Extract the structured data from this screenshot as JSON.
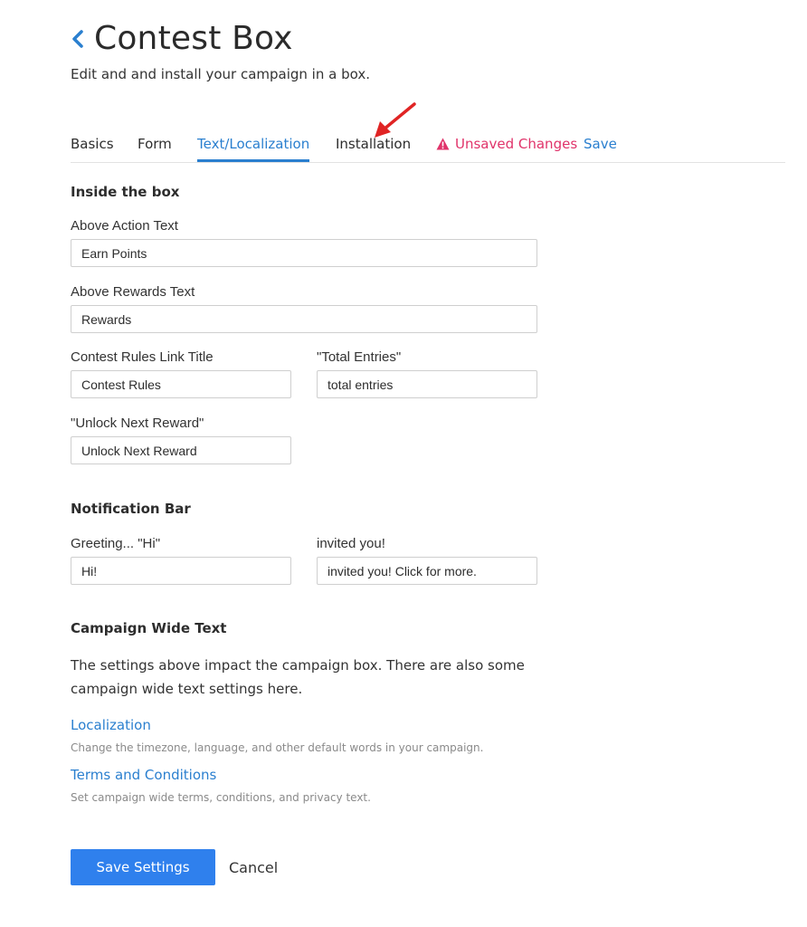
{
  "header": {
    "back_icon": "chevron-left-icon",
    "title": "Contest Box",
    "subtitle": "Edit and and install your campaign in a box."
  },
  "tabs": [
    {
      "label": "Basics",
      "active": false
    },
    {
      "label": "Form",
      "active": false
    },
    {
      "label": "Text/Localization",
      "active": true
    },
    {
      "label": "Installation",
      "active": false
    }
  ],
  "status": {
    "icon": "warning-icon",
    "unsaved_label": "Unsaved Changes",
    "save_label": "Save"
  },
  "annotation": {
    "icon": "red-arrow-icon",
    "color": "#e02424"
  },
  "inside_box": {
    "title": "Inside the box",
    "above_action": {
      "label": "Above Action Text",
      "value": "Earn Points"
    },
    "above_rewards": {
      "label": "Above Rewards Text",
      "value": "Rewards"
    },
    "rules_link": {
      "label": "Contest Rules Link Title",
      "value": "Contest Rules"
    },
    "total_entries": {
      "label": "\"Total Entries\"",
      "value": "total entries"
    },
    "unlock_next": {
      "label": "\"Unlock Next Reward\"",
      "value": "Unlock Next Reward"
    }
  },
  "notification_bar": {
    "title": "Notification Bar",
    "greeting": {
      "label": "Greeting... \"Hi\"",
      "value": "Hi!"
    },
    "invited": {
      "label": "invited you!",
      "value": "invited you! Click for more."
    }
  },
  "campaign_wide": {
    "title": "Campaign Wide Text",
    "description": "The settings above impact the campaign box. There are also some campaign wide text settings here.",
    "links": [
      {
        "title": "Localization",
        "desc": "Change the timezone, language, and other default words in your campaign."
      },
      {
        "title": "Terms and Conditions",
        "desc": "Set campaign wide terms, conditions, and privacy text."
      }
    ]
  },
  "actions": {
    "save_settings": "Save Settings",
    "cancel": "Cancel"
  },
  "colors": {
    "accent": "#2a7fcf",
    "primary_button": "#2f80ed",
    "warning": "#e0336a"
  }
}
